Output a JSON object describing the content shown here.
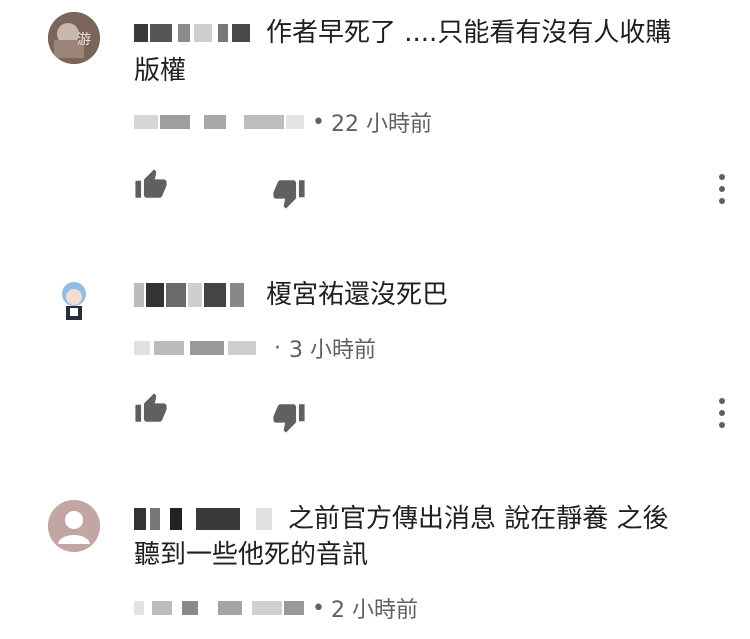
{
  "comments": [
    {
      "text_line1": "作者早死了 ....只能看有沒有人收購",
      "text_line2": "版權",
      "time": "22 小時前",
      "meta_separator": "•"
    },
    {
      "text_line1": "榎宮祐還沒死巴",
      "time": "3 小時前",
      "meta_separator": "·"
    },
    {
      "text_line1": "之前官方傳出消息 說在靜養  之後",
      "text_line2": "聽到一些他死的音訊",
      "time": "2 小時前",
      "meta_separator": "•"
    }
  ],
  "icons": {
    "like": "thumbs-up-icon",
    "dislike": "thumbs-down-icon",
    "more": "more-vertical-icon",
    "avatar_default": "default-avatar-icon"
  },
  "colors": {
    "text": "#1f1f1f",
    "meta": "#606060",
    "icon": "#606060",
    "avatar_default_bg": "#c1a6a4"
  }
}
